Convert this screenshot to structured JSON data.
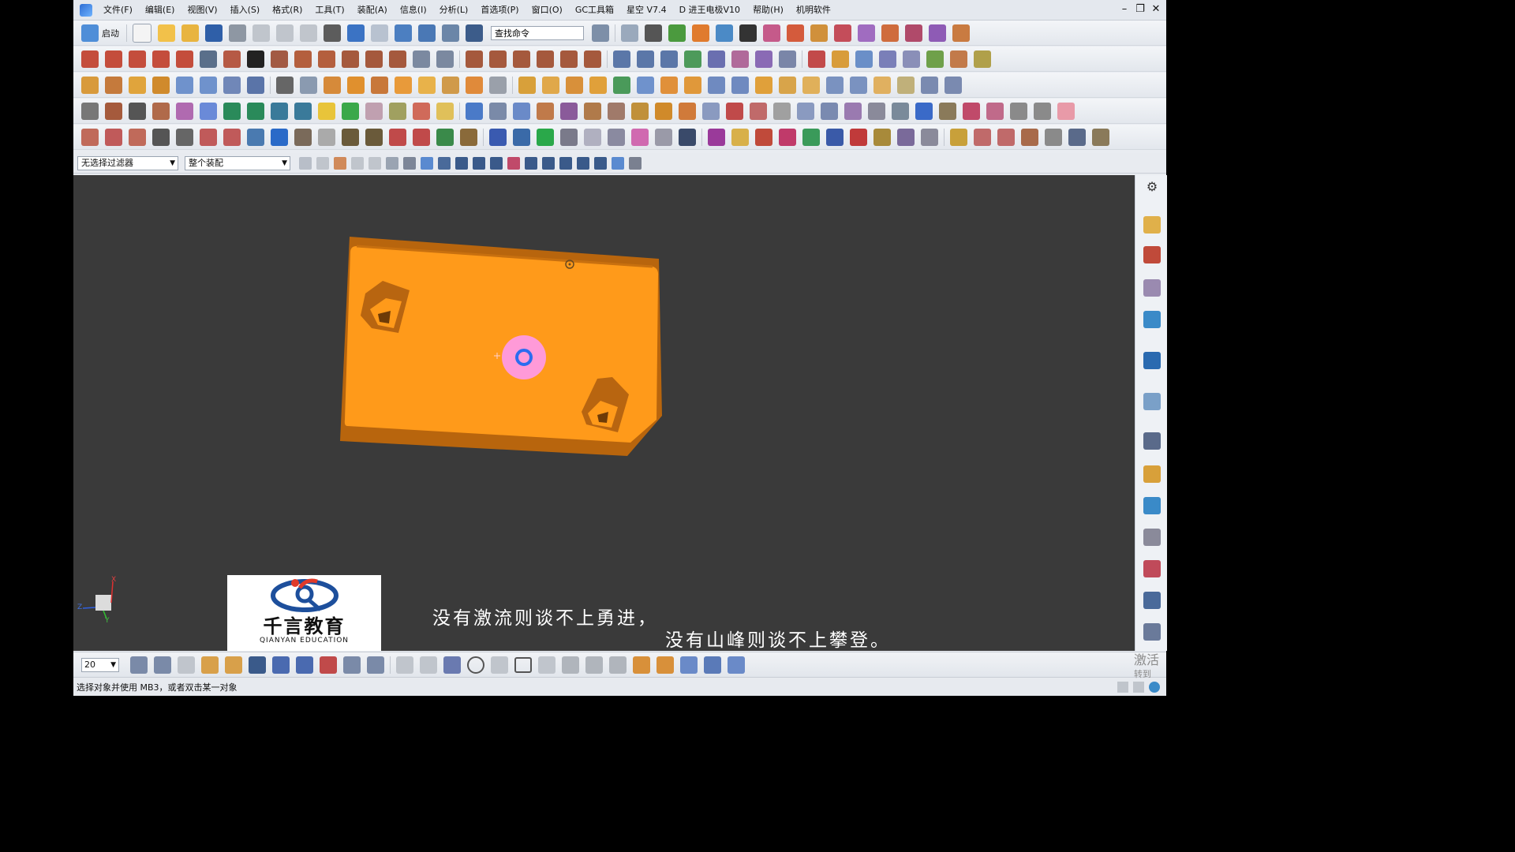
{
  "menubar": {
    "items": [
      "文件(F)",
      "编辑(E)",
      "视图(V)",
      "插入(S)",
      "格式(R)",
      "工具(T)",
      "装配(A)",
      "信息(I)",
      "分析(L)",
      "首选项(P)",
      "窗口(O)",
      "GC工具箱",
      "星空 V7.4",
      "D 进王电极V10",
      "帮助(H)",
      "机明软件"
    ],
    "window_controls": [
      "–",
      "❐",
      "✕"
    ]
  },
  "toolbar": {
    "start_label": "启动",
    "command_search_value": "查找命令"
  },
  "selection_bar": {
    "filter_value": "无选择过滤器",
    "scope_value": "整个装配"
  },
  "viewport": {
    "background": "#3a3a3a",
    "part_color": "#ff9a1a",
    "axis_labels": {
      "x": "X",
      "y": "Y",
      "z": "Z"
    }
  },
  "logo": {
    "name_cn": "千言教育",
    "name_en": "QIANYAN EDUCATION"
  },
  "subtitle": {
    "line1": "没有激流则谈不上勇进，",
    "line2": "没有山峰则谈不上攀登。"
  },
  "bottom_bar": {
    "zoom_value": "20"
  },
  "status": {
    "text": "选择对象并使用 MB3，或者双击某一对象"
  },
  "watermark": {
    "line1": "激活",
    "line2": "转到"
  }
}
